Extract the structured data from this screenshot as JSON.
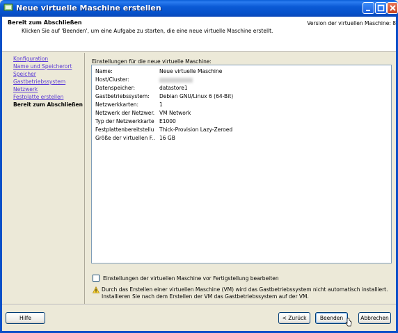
{
  "window": {
    "title": "Neue virtuelle Maschine erstellen"
  },
  "header": {
    "title": "Bereit zum Abschließen",
    "subtitle": "Klicken Sie auf 'Beenden', um eine Aufgabe zu starten, die eine neue virtuelle Maschine erstellt.",
    "version": "Version der virtuellen Maschine: 8"
  },
  "nav": {
    "items": [
      {
        "label": "Konfiguration"
      },
      {
        "label": "Name und Speicherort"
      },
      {
        "label": "Speicher"
      },
      {
        "label": "Gastbetriebssystem"
      },
      {
        "label": "Netzwerk"
      },
      {
        "label": "Festplatte erstellen"
      },
      {
        "label": "Bereit zum Abschließen"
      }
    ]
  },
  "summary": {
    "label": "Einstellungen für die neue virtuelle Maschine:",
    "rows": [
      {
        "key": "Name:",
        "value": "Neue virtuelle Maschine"
      },
      {
        "key": "Host/Cluster:",
        "value": ""
      },
      {
        "key": "Datenspeicher:",
        "value": "datastore1"
      },
      {
        "key": "Gastbetriebssystem:",
        "value": "Debian GNU/Linux 6 (64-Bit)"
      },
      {
        "key": "Netzwerkkarten:",
        "value": "1"
      },
      {
        "key": "Netzwerk der Netzwer...",
        "value": "VM Network"
      },
      {
        "key": "Typ der Netzwerkkarte...",
        "value": "E1000"
      },
      {
        "key": "Festplattenbereitstellu...",
        "value": "Thick-Provision Lazy-Zeroed"
      },
      {
        "key": "Größe der virtuellen F...",
        "value": "16 GB"
      }
    ]
  },
  "options": {
    "edit_checkbox_label": "Einstellungen der virtuellen Maschine vor Fertigstellung bearbeiten",
    "edit_checkbox_checked": false
  },
  "warning": {
    "text": "Durch das Erstellen einer virtuellen Maschine (VM) wird das Gastbetriebssystem nicht automatisch installiert. Installieren Sie nach dem Erstellen der VM das Gastbetriebssystem auf der VM."
  },
  "buttons": {
    "help": "Hilfe",
    "back": "< Zurück",
    "finish": "Beenden",
    "cancel": "Abbrechen"
  },
  "colors": {
    "titlebar": "#0a5fd8",
    "link": "#5b3bd6",
    "dialog_bg": "#ece9d8"
  },
  "icons": {
    "title": "vm-icon",
    "warning": "warning-icon",
    "minimize": "minimize-icon",
    "maximize": "maximize-icon",
    "close": "close-icon"
  }
}
